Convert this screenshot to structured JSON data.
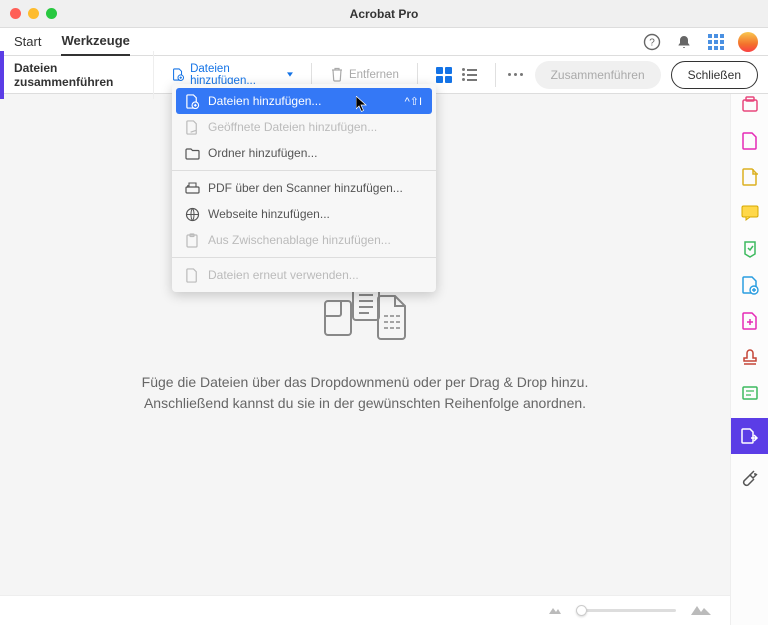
{
  "window": {
    "title": "Acrobat Pro"
  },
  "tabs": {
    "start": "Start",
    "tools": "Werkzeuge"
  },
  "toolbar": {
    "title": "Dateien zusammenführen",
    "add_files": "Dateien hinzufügen...",
    "remove": "Entfernen",
    "merge": "Zusammenführen",
    "close": "Schließen"
  },
  "dropdown": {
    "add_files": "Dateien hinzufügen...",
    "shortcut": "^⇧I",
    "open_files": "Geöffnete Dateien hinzufügen...",
    "add_folder": "Ordner hinzufügen...",
    "scanner": "PDF über den Scanner hinzufügen...",
    "website": "Webseite hinzufügen...",
    "clipboard": "Aus Zwischenablage hinzufügen...",
    "reuse": "Dateien erneut verwenden..."
  },
  "main": {
    "line1": "Füge die Dateien über das Dropdownmenü oder per Drag & Drop hinzu.",
    "line2": "Anschließend kannst du sie in der gewünschten Reihenfolge anordnen."
  }
}
